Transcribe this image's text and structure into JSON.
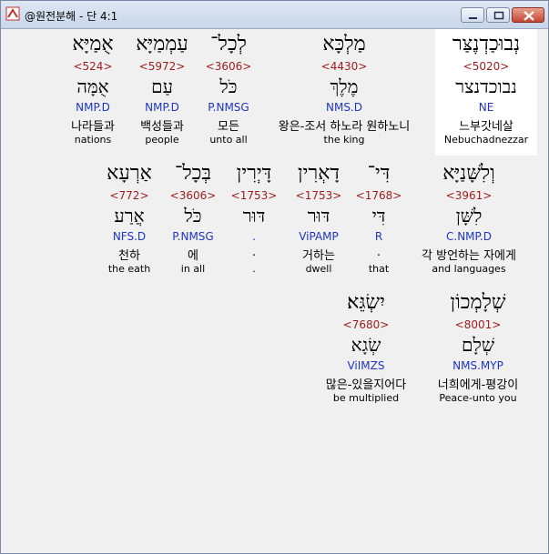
{
  "window": {
    "title": "@원전분해 - 단 4:1"
  },
  "rows": [
    [
      {
        "id": "w1",
        "heb": "נְבוּכַדְנֶצַּר",
        "strong": "<5020>",
        "lemma": "נבוכדנצר",
        "parse": "NE",
        "kor": "느부갓네살",
        "eng": "Nebuchadnezzar"
      },
      {
        "id": "w2",
        "heb": "מַלְכָּא",
        "strong": "<4430>",
        "lemma": "מֶלֶךְ",
        "parse": "NMS.D",
        "kor": "왕은-조서 하노라 원하노니",
        "eng": "the king"
      },
      {
        "id": "w3",
        "heb": "לְכָל־",
        "strong": "<3606>",
        "lemma": "כֹּל",
        "parse": "P.NMSG",
        "kor": "모든",
        "eng": "unto all"
      },
      {
        "id": "w4",
        "heb": "עַמְמַיָּא",
        "strong": "<5972>",
        "lemma": "עַם",
        "parse": "NMP.D",
        "kor": "백성들과",
        "eng": "people"
      },
      {
        "id": "w5",
        "heb": "אֻמַיָּא",
        "strong": "<524>",
        "lemma": "אֻמָּה",
        "parse": "NMP.D",
        "kor": "나라들과",
        "eng": "nations"
      }
    ],
    [
      {
        "id": "w6",
        "heb": "וְלִשָּׁנַיָּא",
        "strong": "<3961>",
        "lemma": "לִשָּׁן",
        "parse": "C.NMP.D",
        "kor": "각 방언하는 자에게",
        "eng": "and languages"
      },
      {
        "id": "w7",
        "heb": "דִּי־",
        "strong": "<1768>",
        "lemma": "דִּי",
        "parse": "R",
        "kor": ".",
        "eng": "that"
      },
      {
        "id": "w8",
        "heb": "דָאְרִין",
        "strong": "<1753>",
        "lemma": "דּוּר",
        "parse": "ViPAMP",
        "kor": "거하는",
        "eng": "dwell"
      },
      {
        "id": "w9",
        "heb": "דָּיְרִין",
        "strong": "<1753>",
        "lemma": "דּוּר",
        "parse": ".",
        "kor": ".",
        "eng": "."
      },
      {
        "id": "w10",
        "heb": "בְּכָל־",
        "strong": "<3606>",
        "lemma": "כֹּל",
        "parse": "P.NMSG",
        "kor": "에",
        "eng": "in all"
      },
      {
        "id": "w11",
        "heb": "אַרְעָא",
        "strong": "<772>",
        "lemma": "אֲרַע",
        "parse": "NFS.D",
        "kor": "천하",
        "eng": "the eath"
      }
    ],
    [
      {
        "id": "w12",
        "heb": "שְׁלָמְכוֹן",
        "strong": "<8001>",
        "lemma": "שְׁלָם",
        "parse": "NMS.MYP",
        "kor": "너희에게-평강이",
        "eng": "Peace-unto you"
      },
      {
        "id": "w13",
        "heb": "יִשְׂגֵּא׃",
        "strong": "<7680>",
        "lemma": "שְׂגָא",
        "parse": "ViIMZS",
        "kor": "많은-있을지어다",
        "eng": "be multiplied"
      }
    ]
  ]
}
